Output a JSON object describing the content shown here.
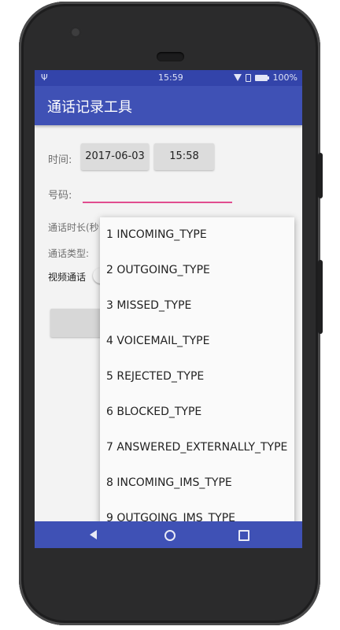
{
  "status_bar": {
    "usb_icon": "usb-icon",
    "time": "15:59",
    "battery_percent": "100%"
  },
  "app_bar": {
    "title": "通话记录工具"
  },
  "form": {
    "time_label": "时间:",
    "date_value": "2017-06-03",
    "time_value": "15:58",
    "number_label": "号码:",
    "number_value": "",
    "duration_label": "通话时长(秒",
    "type_label": "通话类型:",
    "video_label": "视频通话"
  },
  "dropdown": {
    "options": [
      "1 INCOMING_TYPE",
      "2 OUTGOING_TYPE",
      "3 MISSED_TYPE",
      "4 VOICEMAIL_TYPE",
      "5 REJECTED_TYPE",
      "6 BLOCKED_TYPE",
      "7 ANSWERED_EXTERNALLY_TYPE",
      "8 INCOMING_IMS_TYPE",
      "9 OUTGOING_IMS_TYPE"
    ]
  },
  "colors": {
    "app_bar": "#3f51b5",
    "status_bar": "#3344aa",
    "input_accent": "#e14d8f"
  }
}
